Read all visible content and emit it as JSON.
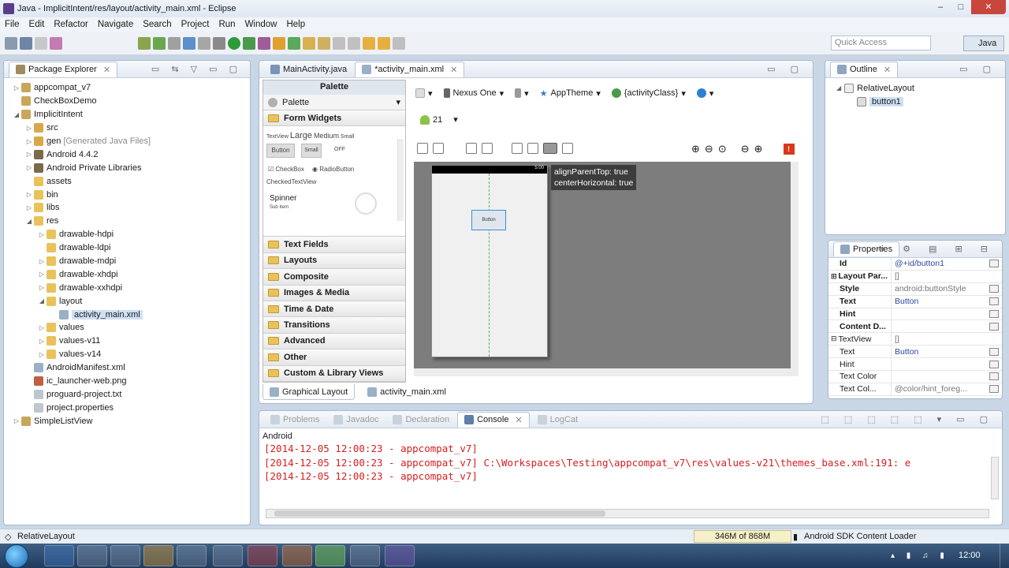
{
  "window": {
    "title": "Java - ImplicitIntent/res/layout/activity_main.xml - Eclipse",
    "controls": [
      "–",
      "□",
      "✕"
    ]
  },
  "menu": [
    "File",
    "Edit",
    "Refactor",
    "Navigate",
    "Search",
    "Project",
    "Run",
    "Window",
    "Help"
  ],
  "toolbar": {
    "quick_access_placeholder": "Quick Access",
    "perspective": "Java"
  },
  "package_explorer": {
    "title": "Package Explorer",
    "items": [
      {
        "depth": 0,
        "twisty": "▷",
        "label": "appcompat_v7",
        "icon": "project-icon",
        "color": "#c8a75a"
      },
      {
        "depth": 0,
        "twisty": "",
        "label": "CheckBoxDemo",
        "icon": "project-icon",
        "color": "#c8a75a"
      },
      {
        "depth": 0,
        "twisty": "◢",
        "label": "ImplicitIntent",
        "icon": "project-icon",
        "color": "#c8a75a"
      },
      {
        "depth": 1,
        "twisty": "▷",
        "label": "src",
        "icon": "source-folder-icon",
        "color": "#d9a84a"
      },
      {
        "depth": 1,
        "twisty": "▷",
        "label": "gen",
        "extra": "[Generated Java Files]",
        "icon": "source-folder-icon",
        "color": "#d9a84a"
      },
      {
        "depth": 1,
        "twisty": "▷",
        "label": "Android 4.4.2",
        "icon": "library-icon",
        "color": "#7a6a4a"
      },
      {
        "depth": 1,
        "twisty": "▷",
        "label": "Android Private Libraries",
        "icon": "library-icon",
        "color": "#7a6a4a"
      },
      {
        "depth": 1,
        "twisty": "",
        "label": "assets",
        "icon": "folder-icon",
        "color": "#e9c25a"
      },
      {
        "depth": 1,
        "twisty": "▷",
        "label": "bin",
        "icon": "folder-icon",
        "color": "#e9c25a"
      },
      {
        "depth": 1,
        "twisty": "▷",
        "label": "libs",
        "icon": "folder-icon",
        "color": "#e9c25a"
      },
      {
        "depth": 1,
        "twisty": "◢",
        "label": "res",
        "icon": "folder-icon",
        "color": "#e9c25a"
      },
      {
        "depth": 2,
        "twisty": "▷",
        "label": "drawable-hdpi",
        "icon": "folder-icon",
        "color": "#e9c25a"
      },
      {
        "depth": 2,
        "twisty": "",
        "label": "drawable-ldpi",
        "icon": "folder-icon",
        "color": "#e9c25a"
      },
      {
        "depth": 2,
        "twisty": "▷",
        "label": "drawable-mdpi",
        "icon": "folder-icon",
        "color": "#e9c25a"
      },
      {
        "depth": 2,
        "twisty": "▷",
        "label": "drawable-xhdpi",
        "icon": "folder-icon",
        "color": "#e9c25a"
      },
      {
        "depth": 2,
        "twisty": "▷",
        "label": "drawable-xxhdpi",
        "icon": "folder-icon",
        "color": "#e9c25a"
      },
      {
        "depth": 2,
        "twisty": "◢",
        "label": "layout",
        "icon": "folder-icon",
        "color": "#e9c25a"
      },
      {
        "depth": 3,
        "twisty": "",
        "label": "activity_main.xml",
        "icon": "xml-file-icon",
        "color": "#9ab0c8",
        "selected": true
      },
      {
        "depth": 2,
        "twisty": "▷",
        "label": "values",
        "icon": "folder-icon",
        "color": "#e9c25a"
      },
      {
        "depth": 2,
        "twisty": "▷",
        "label": "values-v11",
        "icon": "folder-icon",
        "color": "#e9c25a"
      },
      {
        "depth": 2,
        "twisty": "▷",
        "label": "values-v14",
        "icon": "folder-icon",
        "color": "#e9c25a"
      },
      {
        "depth": 1,
        "twisty": "",
        "label": "AndroidManifest.xml",
        "icon": "manifest-file-icon",
        "color": "#9ab0c8"
      },
      {
        "depth": 1,
        "twisty": "",
        "label": "ic_launcher-web.png",
        "icon": "image-file-icon",
        "color": "#c06040"
      },
      {
        "depth": 1,
        "twisty": "",
        "label": "proguard-project.txt",
        "icon": "text-file-icon",
        "color": "#bfc6ce"
      },
      {
        "depth": 1,
        "twisty": "",
        "label": "project.properties",
        "icon": "text-file-icon",
        "color": "#bfc6ce"
      },
      {
        "depth": 0,
        "twisty": "▷",
        "label": "SimpleListView",
        "icon": "project-icon",
        "color": "#c8a75a"
      }
    ]
  },
  "editor": {
    "tabs": [
      {
        "label": "MainActivity.java",
        "active": false
      },
      {
        "label": "*activity_main.xml",
        "active": true
      }
    ],
    "palette_title": "Palette",
    "palette_combo": "Palette",
    "palette_categories": [
      "Form Widgets",
      "Text Fields",
      "Layouts",
      "Composite",
      "Images & Media",
      "Time & Date",
      "Transitions",
      "Advanced",
      "Other",
      "Custom & Library Views"
    ],
    "widgets": {
      "textview_label": "TextView",
      "large": "Large",
      "medium": "Medium",
      "small": "Small",
      "button": "Button",
      "small_button": "Small",
      "toggle": "OFF",
      "checkbox": "CheckBox",
      "radio": "RadioButton",
      "checked": "CheckedTextView",
      "spinner": "Spinner",
      "spinner_sub": "Sub Item"
    },
    "config": {
      "device": "Nexus One",
      "theme": "AppTheme",
      "activity": "{activityClass}",
      "api": "21"
    },
    "device_status": "5:00",
    "selected_widget": "Button",
    "tooltip_lines": [
      "alignParentTop: true",
      "centerHorizontal: true"
    ],
    "error_badge": "!",
    "bottom_tabs": [
      "Graphical Layout",
      "activity_main.xml"
    ]
  },
  "outline": {
    "title": "Outline",
    "items": [
      {
        "label": "RelativeLayout",
        "depth": 0
      },
      {
        "label": "button1",
        "depth": 1
      }
    ]
  },
  "properties": {
    "title": "Properties",
    "rows": [
      {
        "key": "Id",
        "value": "@+id/button1",
        "bold": true,
        "button": true
      },
      {
        "key": "Layout Par...",
        "value": "[]",
        "bold": true,
        "gray": true,
        "expand": "⊞"
      },
      {
        "key": "Style",
        "value": "android:buttonStyle",
        "bold": true,
        "gray": true,
        "button": true
      },
      {
        "key": "Text",
        "value": "Button",
        "bold": true,
        "button": true
      },
      {
        "key": "Hint",
        "value": "",
        "bold": true,
        "button": true
      },
      {
        "key": "Content D...",
        "value": "",
        "bold": true,
        "button": true
      },
      {
        "key": "TextView",
        "value": "[]",
        "bold": false,
        "gray": true,
        "expand": "⊟"
      },
      {
        "key": "Text",
        "value": "Button",
        "bold": false,
        "button": true
      },
      {
        "key": "Hint",
        "value": "",
        "bold": false,
        "button": true
      },
      {
        "key": "Text Color",
        "value": "",
        "bold": false,
        "button": true
      },
      {
        "key": "Text Col...",
        "value": "@color/hint_foreg...",
        "bold": false,
        "gray": true,
        "button": true
      }
    ]
  },
  "console": {
    "tabs": [
      "Problems",
      "Javadoc",
      "Declaration",
      "Console",
      "LogCat"
    ],
    "active_tab": "Console",
    "header": "Android",
    "lines": [
      "[2014-12-05 12:00:23 - appcompat_v7]",
      "[2014-12-05 12:00:23 - appcompat_v7] C:\\Workspaces\\Testing\\appcompat_v7\\res\\values-v21\\themes_base.xml:191: e",
      "[2014-12-05 12:00:23 - appcompat_v7]"
    ]
  },
  "status": {
    "left": "RelativeLayout",
    "memory": "346M of 868M",
    "task": "Android SDK Content Loader"
  },
  "taskbar": {
    "clock": "12:00"
  }
}
